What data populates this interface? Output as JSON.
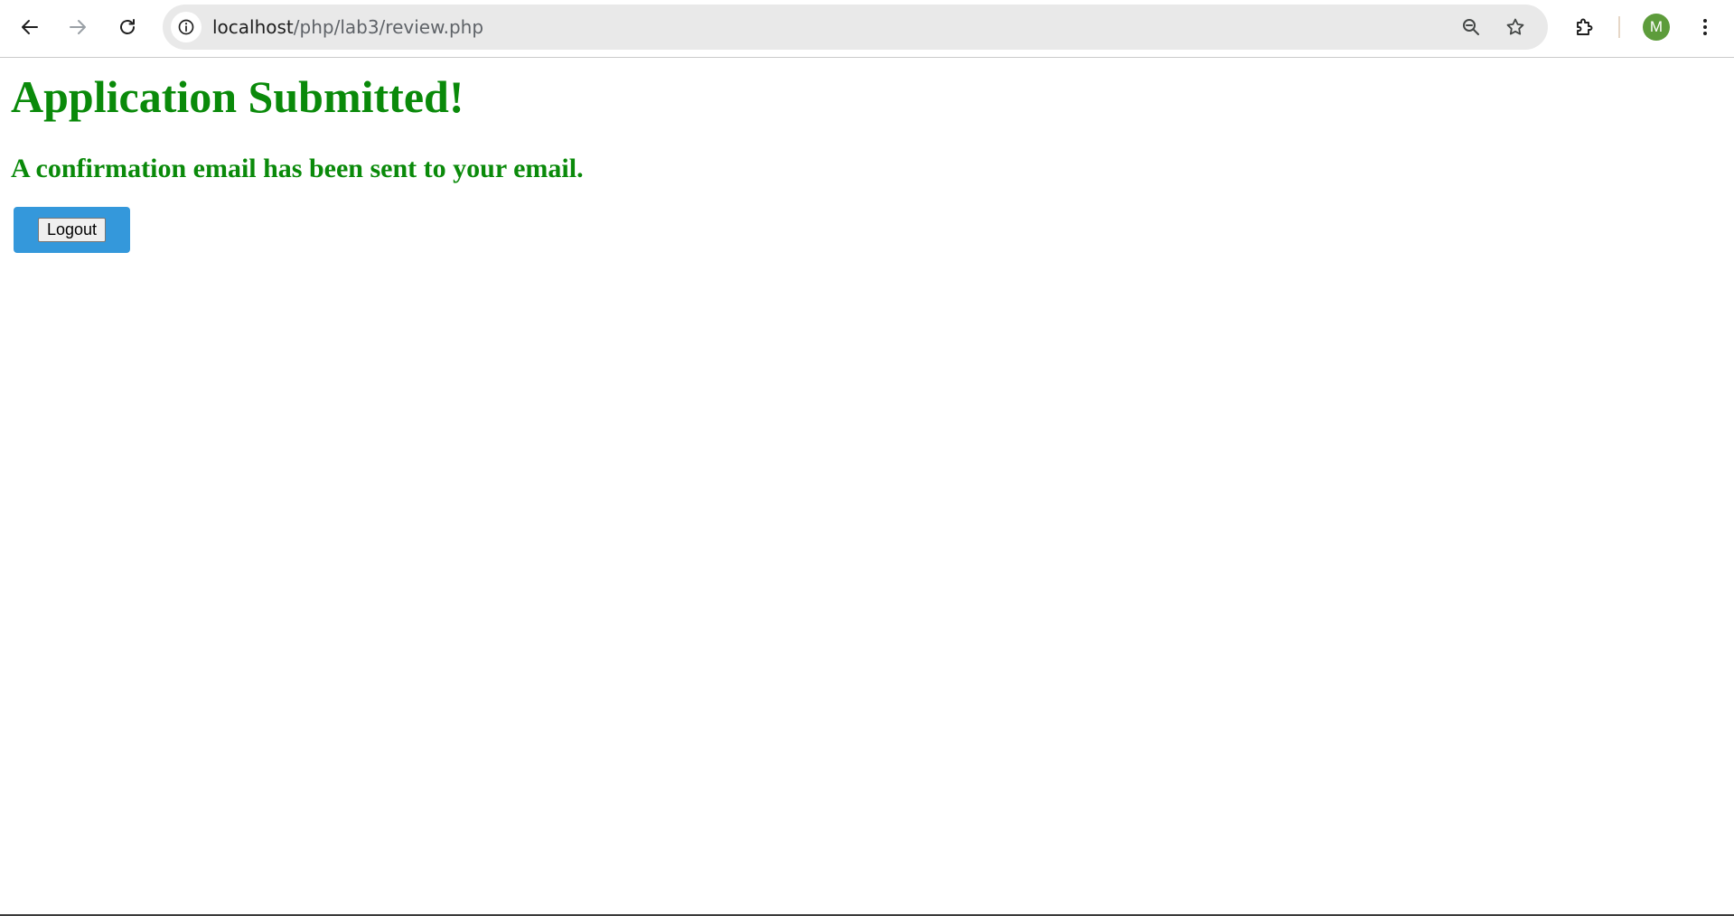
{
  "browser": {
    "url_host": "localhost",
    "url_path": "/php/lab3/review.php",
    "profile_initial": "M",
    "icons": {
      "back": "arrow-left-icon",
      "forward": "arrow-right-icon",
      "reload": "reload-icon",
      "site_info": "info-icon",
      "zoom": "zoom-out-icon",
      "bookmark": "star-icon",
      "extensions": "puzzle-icon",
      "menu": "kebab-menu-icon"
    }
  },
  "page": {
    "heading": "Application Submitted!",
    "message": "A confirmation email has been sent to your email.",
    "logout_label": "Logout"
  },
  "colors": {
    "heading_text": "#0a8a0a",
    "button_container": "#3498db",
    "avatar": "#5d9c3b",
    "omnibox": "#e9e9e9"
  }
}
